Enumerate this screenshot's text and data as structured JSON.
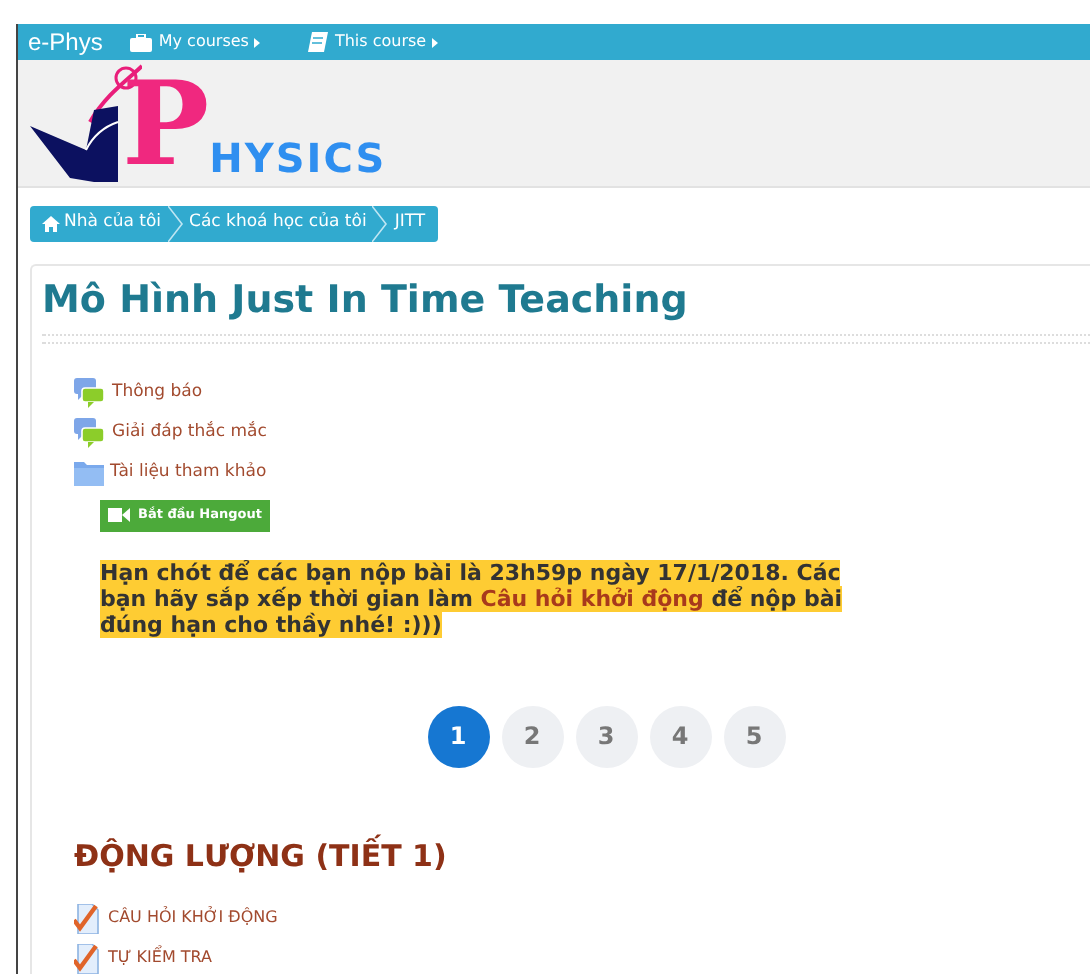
{
  "navbar": {
    "brand": "e-Phys",
    "menus": [
      {
        "label": "My courses",
        "kind": "briefcase"
      },
      {
        "label": "This course",
        "kind": "book"
      }
    ]
  },
  "logo": {
    "initial": "P",
    "rest": "HYSICS"
  },
  "breadcrumb": [
    {
      "label": "Nhà của tôi",
      "kind": "home"
    },
    {
      "label": "Các khoá học của tôi",
      "kind": "link"
    },
    {
      "label": "JITT",
      "kind": "link"
    }
  ],
  "page_title": "Mô Hình Just In Time Teaching",
  "activities": [
    {
      "label": "Thông báo",
      "kind": "forum"
    },
    {
      "label": "Giải đáp thắc mắc",
      "kind": "forum"
    },
    {
      "label": "Tài liệu tham khảo",
      "kind": "folder"
    }
  ],
  "hangout_button": "Bắt đầu Hangout",
  "notice": {
    "before": "Hạn chót để các bạn nộp bài là 23h59p ngày 17/1/2018. Các bạn hãy sắp xếp thời gian làm ",
    "link": "Câu hỏi khởi động",
    "after": " để nộp bài đúng hạn cho thầy nhé! :)))"
  },
  "pagination": [
    {
      "label": "1",
      "selected": true
    },
    {
      "label": "2",
      "selected": false
    },
    {
      "label": "3",
      "selected": false
    },
    {
      "label": "4",
      "selected": false
    },
    {
      "label": "5",
      "selected": false
    }
  ],
  "section": {
    "title": "ĐỘNG LƯỢNG (TIẾT 1)",
    "items": [
      {
        "label": "CÂU HỎI KHỞI ĐỘNG"
      },
      {
        "label": "TỰ KIỂM TRA"
      }
    ]
  }
}
